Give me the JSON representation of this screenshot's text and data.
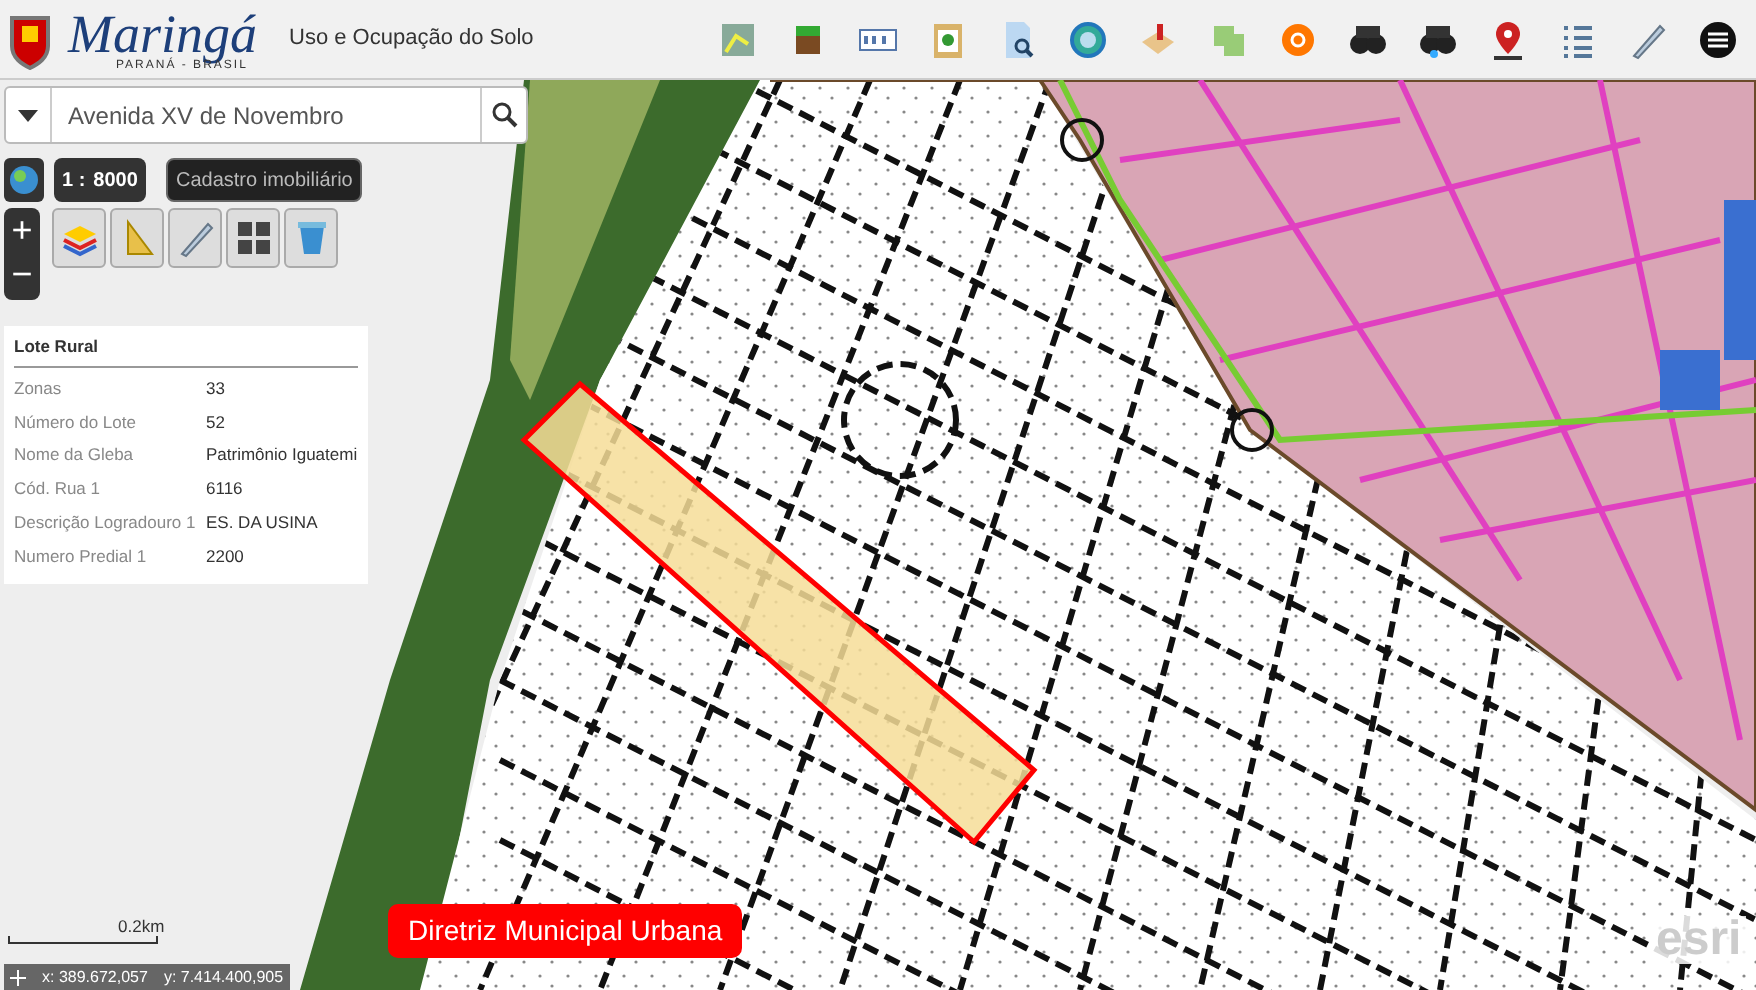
{
  "header": {
    "logo_title": "Maringá",
    "logo_subtitle": "PARANÁ - BRASIL",
    "app_title": "Uso e Ocupação do Solo"
  },
  "search": {
    "value": "Avenida XV de Novembro"
  },
  "scale": {
    "prefix": "1 :",
    "value": "8000"
  },
  "layer_button": "Cadastro imobiliário",
  "zoom": {
    "in": "+",
    "out": "−"
  },
  "popup": {
    "title": "Lote Rural",
    "fields": [
      {
        "label": "Zonas",
        "value": "33"
      },
      {
        "label": "Número do Lote",
        "value": "52"
      },
      {
        "label": "Nome da Gleba",
        "value": "Patrimônio Iguatemi"
      },
      {
        "label": "Cód. Rua 1",
        "value": "6116"
      },
      {
        "label": "Descrição Logradouro 1",
        "value": "ES. DA USINA"
      },
      {
        "label": "Numero Predial 1",
        "value": "2200"
      }
    ]
  },
  "scalebar": "0.2km",
  "coordinates": {
    "x": "x: 389.672,057",
    "y": "y: 7.414.400,905"
  },
  "map_label": "Diretriz Municipal Urbana",
  "attribution": "esri"
}
